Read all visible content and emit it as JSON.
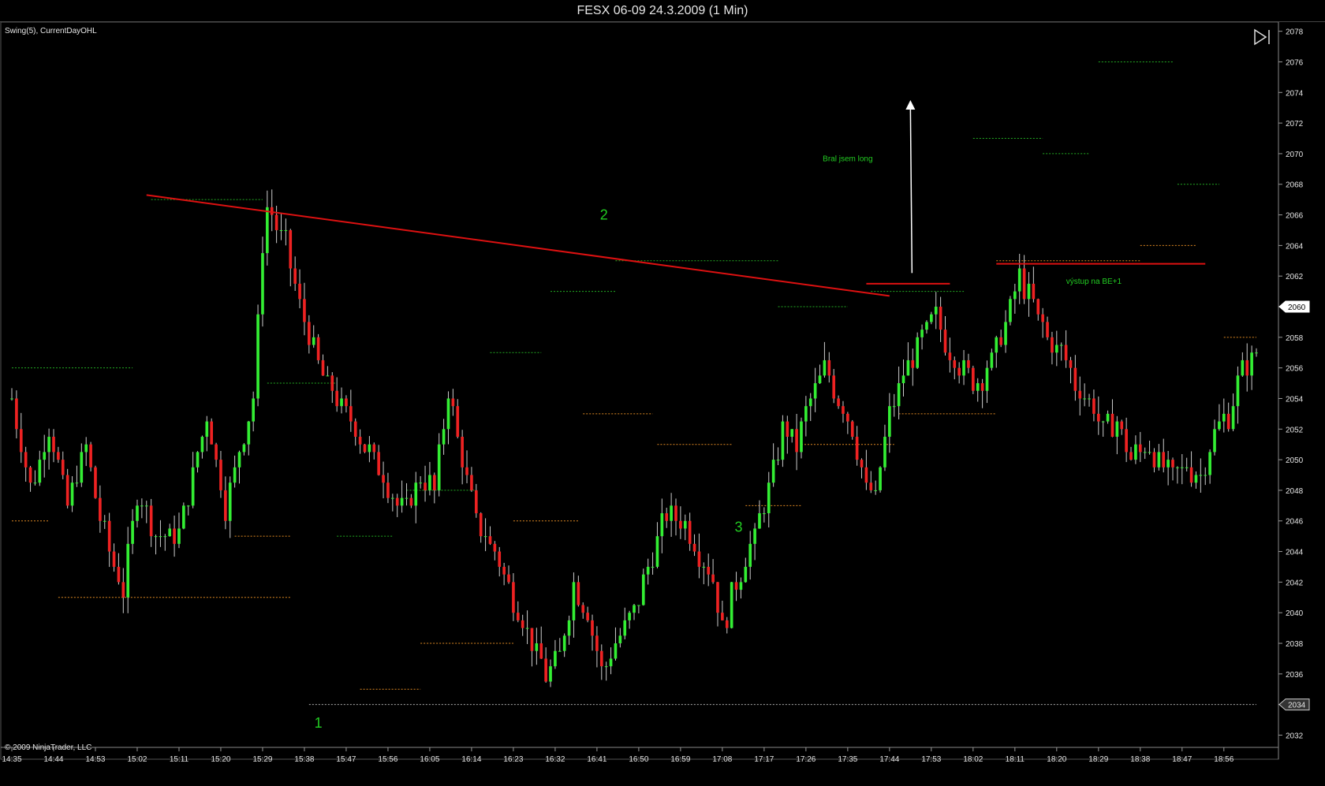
{
  "window": {
    "title": "FESX 06-09  24.3.2009 (1 Min)"
  },
  "indicators_label": "Swing(5), CurrentDayOHL",
  "copyright": "© 2009 NinjaTrader, LLC",
  "colors": {
    "background": "#000000",
    "up_candle": "#33ee33",
    "down_candle": "#ee2222",
    "wick": "#cccccc",
    "trendline": "#dd1111",
    "annotation_text": "#22cc22",
    "swing_high": "#22aa22",
    "swing_low": "#dd8822",
    "arrow": "#ffffff"
  },
  "chart_data": {
    "type": "candlestick",
    "x_ticks": [
      "14:35",
      "14:44",
      "14:53",
      "15:02",
      "15:11",
      "15:20",
      "15:29",
      "15:38",
      "15:47",
      "15:56",
      "16:05",
      "16:14",
      "16:23",
      "16:32",
      "16:41",
      "16:50",
      "16:59",
      "17:08",
      "17:17",
      "17:26",
      "17:35",
      "17:44",
      "17:53",
      "18:02",
      "18:11",
      "18:20",
      "18:29",
      "18:38",
      "18:47",
      "18:56"
    ],
    "y_ticks": [
      2078,
      2076,
      2074,
      2072,
      2070,
      2068,
      2066,
      2064,
      2062,
      2060,
      2058,
      2056,
      2054,
      2052,
      2050,
      2048,
      2046,
      2044,
      2042,
      2040,
      2038,
      2036,
      2034,
      2032
    ],
    "ylim": [
      2031.2,
      2078.6
    ],
    "xlim_minutes": [
      0,
      268
    ],
    "last_price": 2060,
    "current_low_marker": 2034,
    "anchors": [
      [
        0,
        2054
      ],
      [
        4,
        2048
      ],
      [
        8,
        2052
      ],
      [
        12,
        2047
      ],
      [
        16,
        2051
      ],
      [
        19,
        2046
      ],
      [
        24,
        2041.5
      ],
      [
        27,
        2048
      ],
      [
        31,
        2045
      ],
      [
        36,
        2045
      ],
      [
        42,
        2053
      ],
      [
        46,
        2047
      ],
      [
        52,
        2054
      ],
      [
        54,
        2064
      ],
      [
        55,
        2066.5
      ],
      [
        59,
        2064
      ],
      [
        62,
        2060
      ],
      [
        66,
        2056
      ],
      [
        70,
        2054
      ],
      [
        76,
        2051
      ],
      [
        80,
        2049
      ],
      [
        83,
        2047
      ],
      [
        85,
        2047
      ],
      [
        88,
        2049
      ],
      [
        91,
        2048
      ],
      [
        94,
        2054.5
      ],
      [
        97,
        2050
      ],
      [
        100,
        2046
      ],
      [
        104,
        2044
      ],
      [
        108,
        2041
      ],
      [
        112,
        2038
      ],
      [
        115,
        2036
      ],
      [
        118,
        2037
      ],
      [
        121,
        2042
      ],
      [
        124,
        2040
      ],
      [
        127,
        2036
      ],
      [
        130,
        2038
      ],
      [
        134,
        2040
      ],
      [
        138,
        2044
      ],
      [
        141,
        2046.5
      ],
      [
        145,
        2046
      ],
      [
        148,
        2044
      ],
      [
        151,
        2042
      ],
      [
        153,
        2039
      ],
      [
        156,
        2042
      ],
      [
        160,
        2045
      ],
      [
        163,
        2048
      ],
      [
        166,
        2052
      ],
      [
        169,
        2051
      ],
      [
        172,
        2054
      ],
      [
        175,
        2056
      ],
      [
        178,
        2054
      ],
      [
        181,
        2052
      ],
      [
        184,
        2048
      ],
      [
        186,
        2047.5
      ],
      [
        189,
        2053
      ],
      [
        192,
        2055.5
      ],
      [
        196,
        2058
      ],
      [
        199,
        2059.5
      ],
      [
        202,
        2057
      ],
      [
        205,
        2056
      ],
      [
        208,
        2055
      ],
      [
        212,
        2057
      ],
      [
        215,
        2060
      ],
      [
        217,
        2062
      ],
      [
        220,
        2060
      ],
      [
        223,
        2058
      ],
      [
        226,
        2057
      ],
      [
        229,
        2055
      ],
      [
        232,
        2054
      ],
      [
        235,
        2052
      ],
      [
        238,
        2052.5
      ],
      [
        241,
        2050
      ],
      [
        244,
        2051
      ],
      [
        247,
        2050
      ],
      [
        250,
        2049
      ],
      [
        253,
        2049.5
      ],
      [
        256,
        2049
      ],
      [
        259,
        2052
      ],
      [
        262,
        2053
      ],
      [
        265,
        2056
      ],
      [
        268,
        2057
      ]
    ],
    "swing_highs": [
      {
        "value": 2056,
        "x0": 0,
        "x1": 26
      },
      {
        "value": 2067,
        "x0": 30,
        "x1": 54
      },
      {
        "value": 2055,
        "x0": 55,
        "x1": 70
      },
      {
        "value": 2045,
        "x0": 70,
        "x1": 82
      },
      {
        "value": 2048,
        "x0": 85,
        "x1": 100
      },
      {
        "value": 2057,
        "x0": 103,
        "x1": 114
      },
      {
        "value": 2061,
        "x0": 116,
        "x1": 130
      },
      {
        "value": 2063,
        "x0": 130,
        "x1": 165
      },
      {
        "value": 2060,
        "x0": 165,
        "x1": 180
      },
      {
        "value": 2061,
        "x0": 185,
        "x1": 205
      },
      {
        "value": 2071,
        "x0": 207,
        "x1": 222
      },
      {
        "value": 2070,
        "x0": 222,
        "x1": 232
      },
      {
        "value": 2076,
        "x0": 234,
        "x1": 250
      },
      {
        "value": 2068,
        "x0": 251,
        "x1": 260
      }
    ],
    "swing_lows": [
      {
        "value": 2046,
        "x0": 0,
        "x1": 8
      },
      {
        "value": 2041,
        "x0": 10,
        "x1": 60
      },
      {
        "value": 2045,
        "x0": 48,
        "x1": 60
      },
      {
        "value": 2034,
        "x0": 64,
        "x1": 268
      },
      {
        "value": 2035,
        "x0": 75,
        "x1": 88
      },
      {
        "value": 2038,
        "x0": 88,
        "x1": 108
      },
      {
        "value": 2046,
        "x0": 108,
        "x1": 122
      },
      {
        "value": 2053,
        "x0": 123,
        "x1": 138
      },
      {
        "value": 2051,
        "x0": 139,
        "x1": 155
      },
      {
        "value": 2047,
        "x0": 158,
        "x1": 170
      },
      {
        "value": 2051,
        "x0": 170,
        "x1": 190
      },
      {
        "value": 2053,
        "x0": 191,
        "x1": 212
      },
      {
        "value": 2063,
        "x0": 212,
        "x1": 243
      },
      {
        "value": 2064,
        "x0": 243,
        "x1": 255
      },
      {
        "value": 2058,
        "x0": 261,
        "x1": 268
      }
    ],
    "trendline": {
      "x0": 29,
      "y0": 2067.3,
      "x1": 189,
      "y1": 2060.7
    },
    "levels": [
      {
        "x0": 184,
        "x1": 202,
        "value": 2061.5
      },
      {
        "x0": 212,
        "x1": 257,
        "value": 2062.8
      }
    ],
    "arrow": {
      "x": 193.5,
      "y_from": 2062.2,
      "y_to": 2073.5
    },
    "annotations": [
      {
        "label": "1",
        "x": 66,
        "y": 2032.5
      },
      {
        "label": "2",
        "x": 127.5,
        "y": 2065.7
      },
      {
        "label": "3",
        "x": 156.5,
        "y": 2045.3
      },
      {
        "label": "Bral jsem long",
        "x": 180,
        "y": 2069.5
      },
      {
        "label": "výstup na BE+1",
        "x": 233,
        "y": 2061.5
      }
    ]
  }
}
